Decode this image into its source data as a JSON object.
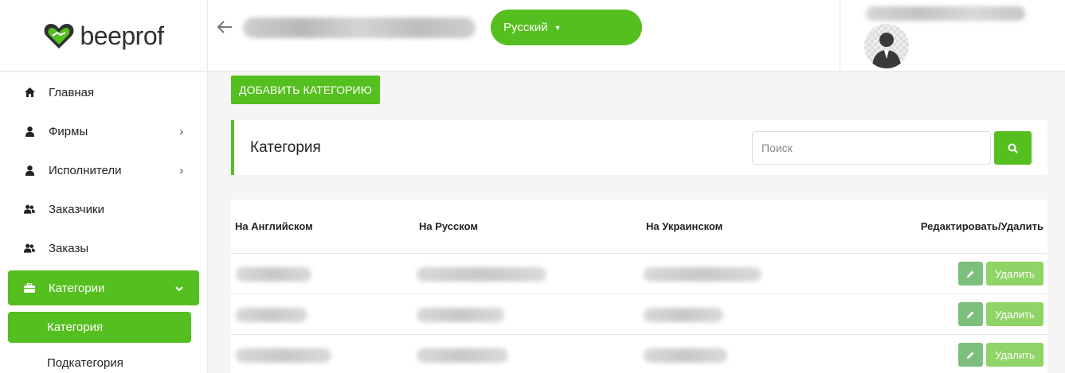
{
  "header": {
    "logo_part1": "bee",
    "logo_part2": "prof",
    "back_icon": "arrow-left-icon",
    "language_label": "Русский"
  },
  "sidebar": {
    "items": [
      {
        "label": "Главная",
        "icon": "home-icon"
      },
      {
        "label": "Фирмы",
        "icon": "user-icon"
      },
      {
        "label": "Исполнители",
        "icon": "user-icon"
      },
      {
        "label": "Заказчики",
        "icon": "users-icon"
      },
      {
        "label": "Заказы",
        "icon": "users-icon"
      },
      {
        "label": "Категории",
        "icon": "briefcase-icon"
      }
    ],
    "subitems": [
      {
        "label": "Категория"
      },
      {
        "label": "Подкатегория"
      }
    ]
  },
  "main": {
    "add_button": "ДОБАВИТЬ КАТЕГОРИЮ",
    "panel_title": "Категория",
    "search_placeholder": "Поиск",
    "table": {
      "columns": [
        "На Английском",
        "На Русском",
        "На Украинском",
        "Редактировать/Удалить"
      ],
      "delete_label": "Удалить"
    }
  },
  "colors": {
    "accent": "#55bf1f",
    "edit_button": "#7cbf7c",
    "delete_button": "#8fd467"
  }
}
